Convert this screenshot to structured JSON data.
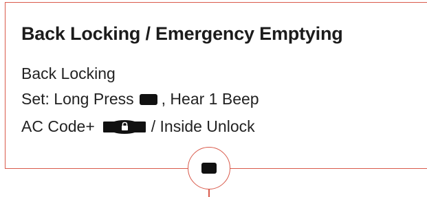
{
  "title": "Back Locking / Emergency Emptying",
  "lines": {
    "line1": "Back Locking",
    "line2_before": "Set: Long Press",
    "line2_after": ", Hear 1 Beep",
    "line3_before": "AC Code+",
    "line3_after": "/ Inside Unlock"
  },
  "icons": {
    "key": "black-key-button-icon",
    "lock_key": "lock-key-icon",
    "circle_key": "round-button-key-icon"
  },
  "colors": {
    "accent": "#d9594a",
    "text": "#222222",
    "key_fill": "#111111"
  }
}
